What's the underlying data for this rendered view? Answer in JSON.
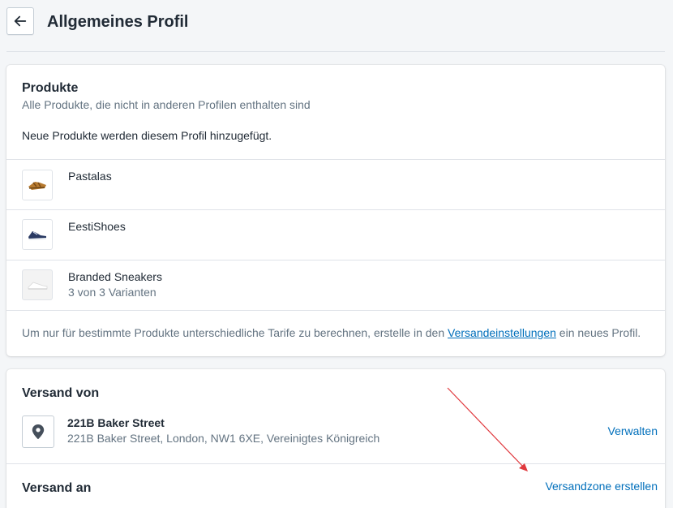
{
  "header": {
    "title": "Allgemeines Profil"
  },
  "products_card": {
    "title": "Produkte",
    "subtitle": "Alle Produkte, die nicht in anderen Profilen enthalten sind",
    "note": "Neue Produkte werden diesem Profil hinzugefügt.",
    "items": [
      {
        "name": "Pastalas",
        "detail": ""
      },
      {
        "name": "EestiShoes",
        "detail": ""
      },
      {
        "name": "Branded Sneakers",
        "detail": "3 von 3 Varianten"
      }
    ],
    "footer_prefix": "Um nur für bestimmte Produkte unterschiedliche Tarife zu berechnen, erstelle in den ",
    "footer_link": "Versandeinstellungen",
    "footer_suffix": " ein neues Profil."
  },
  "shipping_card": {
    "from_title": "Versand von",
    "location_name": "221B Baker Street",
    "location_address": "221B Baker Street, London, NW1 6XE, Vereinigtes Königreich",
    "manage_label": "Verwalten",
    "to_title": "Versand an",
    "create_zone_label": "Versandzone erstellen"
  },
  "colors": {
    "link": "#006fbb",
    "annotation_arrow": "#e0393e"
  },
  "icons": {
    "back": "arrow-left-icon",
    "location": "location-pin-icon"
  }
}
